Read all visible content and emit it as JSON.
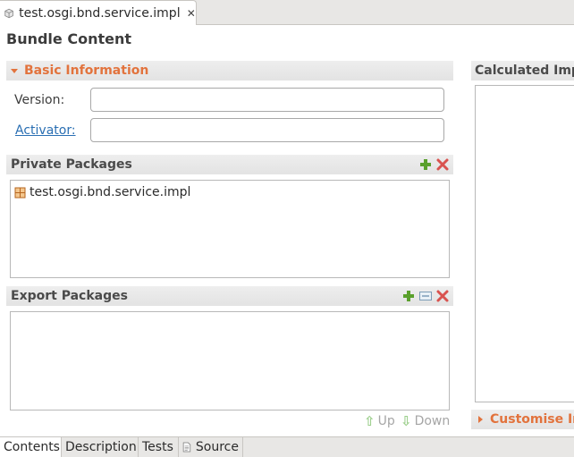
{
  "editor": {
    "tab_title": "test.osgi.bnd.service.impl",
    "tab_icon": "bundle-file-icon",
    "close_icon": "close-icon"
  },
  "form": {
    "title": "Bundle Content"
  },
  "basic_information": {
    "title": "Basic Information",
    "version_label": "Version:",
    "version_value": "",
    "activator_label": "Activator:",
    "activator_value": ""
  },
  "private_packages": {
    "title": "Private Packages",
    "items": [
      {
        "label": "test.osgi.bnd.service.impl",
        "icon": "package-icon"
      }
    ],
    "actions": [
      "add-icon",
      "remove-icon"
    ]
  },
  "export_packages": {
    "title": "Export Packages",
    "items": [],
    "actions": [
      "add-icon",
      "edit-icon",
      "remove-icon"
    ],
    "up_label": "Up",
    "down_label": "Down"
  },
  "calculated_imports": {
    "title": "Calculated Impo"
  },
  "customise_imports": {
    "title": "Customise Im"
  },
  "page_tabs": [
    {
      "label": "Contents",
      "active": true
    },
    {
      "label": "Description",
      "active": false
    },
    {
      "label": "Tests",
      "active": false
    },
    {
      "label": "Source",
      "active": false,
      "icon": "source-file-icon"
    }
  ],
  "colors": {
    "section_accent": "#e2733d",
    "link": "#2a6fb3",
    "add": "#5aa02c",
    "remove": "#d9534f"
  }
}
